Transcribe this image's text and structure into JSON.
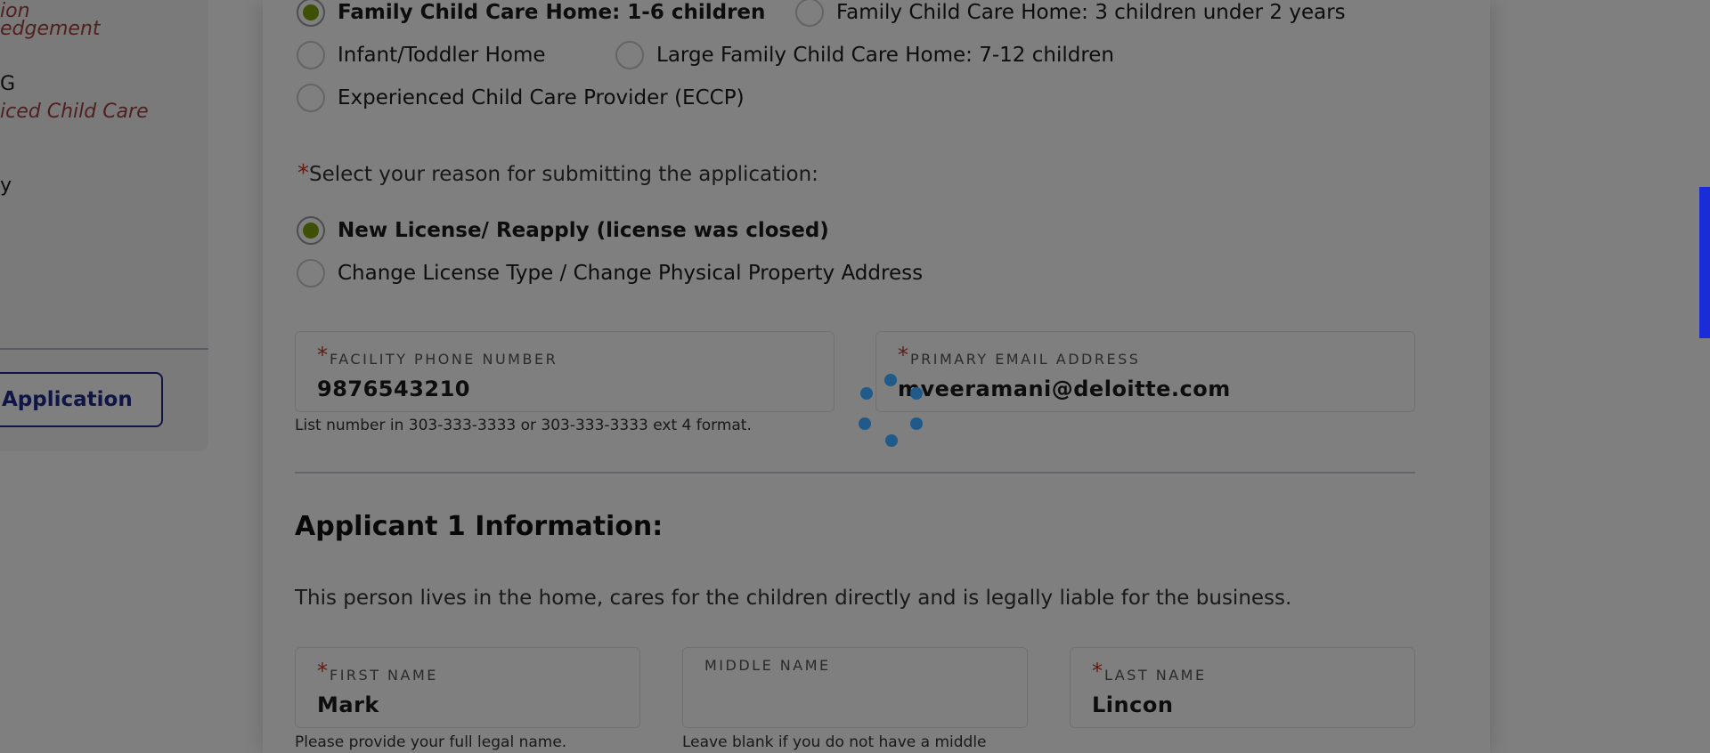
{
  "sidebar": {
    "lines": [
      {
        "text": "ion",
        "style": "link"
      },
      {
        "text": "edgement",
        "style": "link"
      },
      {
        "text": "G",
        "style": "text"
      },
      {
        "text": "iced Child Care",
        "style": "link"
      },
      {
        "text": "y",
        "style": "text"
      }
    ],
    "button_label": "Application"
  },
  "license_types": [
    {
      "label": "Family Child Care Home: 1-6 children",
      "checked": true
    },
    {
      "label": "Family Child Care Home: 3 children under 2 years",
      "checked": false
    },
    {
      "label": "Infant/Toddler Home",
      "checked": false
    },
    {
      "label": "Large Family Child Care Home: 7-12 children",
      "checked": false
    },
    {
      "label": "Experienced Child Care Provider (ECCP)",
      "checked": false
    }
  ],
  "reason": {
    "required_mark": "*",
    "question": "Select your reason for submitting the application:",
    "options": [
      {
        "label": "New License/ Reapply (license was closed)",
        "checked": true
      },
      {
        "label": "Change License Type / Change Physical Property Address",
        "checked": false
      }
    ]
  },
  "facility_phone": {
    "label": "FACILITY PHONE NUMBER",
    "value": "9876543210",
    "hint": "List number in 303-333-3333 or 303-333-3333 ext 4 format."
  },
  "primary_email": {
    "label": "PRIMARY EMAIL ADDRESS",
    "value": "mveeramani@deloitte.com"
  },
  "applicant": {
    "title": "Applicant 1 Information:",
    "description": "This person lives in the home, cares for the children directly and is legally liable for the business.",
    "first_name": {
      "label": "FIRST NAME",
      "value": "Mark",
      "hint": "Please provide your full legal name."
    },
    "middle_name": {
      "label": "MIDDLE NAME",
      "value": "",
      "hint": "Leave blank if you do not have a middle"
    },
    "last_name": {
      "label": "LAST NAME",
      "value": "Lincon"
    }
  },
  "colors": {
    "overlay": "rgba(0,0,0,0.5)",
    "radio_checked": "#7aa10c",
    "required": "#c0392b",
    "accent": "#1f2a88",
    "spinner": "#1f5a8a"
  }
}
